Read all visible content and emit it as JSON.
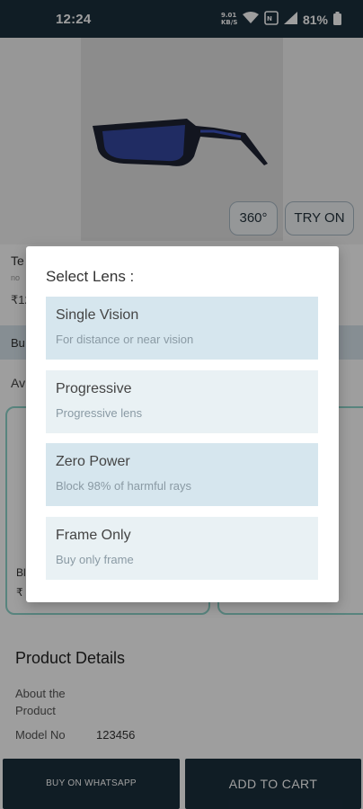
{
  "status_bar": {
    "time": "12:24",
    "battery": "81%",
    "net_speed": "9.01\nKB/S"
  },
  "product": {
    "view_360_label": "360°",
    "try_on_label": "TRY ON",
    "title_partial": "Te",
    "subtitle_partial": "no",
    "price_partial": "₹12",
    "band_partial": "Bu",
    "available_partial": "Av",
    "card1_label_partial": "Bl",
    "card1_price_partial": "₹",
    "details_title": "Product Details",
    "about_label": "About the Product",
    "model_label": "Model No",
    "model_value": "123456"
  },
  "footer": {
    "whatsapp_label": "BUY ON WHATSAPP",
    "cart_label": "ADD TO CART"
  },
  "lens_dialog": {
    "title": "Select Lens :",
    "options": [
      {
        "name": "Single Vision",
        "description": "For distance or near vision"
      },
      {
        "name": "Progressive",
        "description": "Progressive lens"
      },
      {
        "name": "Zero Power",
        "description": "Block 98% of harmful rays"
      },
      {
        "name": "Frame Only",
        "description": "Buy only frame"
      }
    ]
  },
  "colors": {
    "primary_dark": "#1b2f3d",
    "option_highlight": "#d6e6ee",
    "option_light": "#e9f1f4",
    "card_border": "#8fd6cc"
  },
  "icons": [
    "wifi-icon",
    "signal-icon",
    "battery-icon",
    "data-speed-icon",
    "nfc-icon"
  ]
}
